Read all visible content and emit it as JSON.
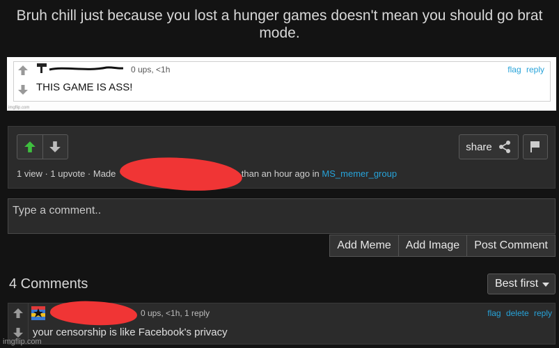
{
  "post": {
    "title": "Bruh chill just because you lost a hunger games doesn't mean you should go brat mode."
  },
  "meme_image": {
    "meta": "0 ups, <1h",
    "flag_label": "flag",
    "reply_label": "reply",
    "comment_text": "THIS GAME IS ASS!",
    "watermark": "imgflip.com"
  },
  "stats": {
    "views": "1 view",
    "upvotes": "1 upvote",
    "made_by_prefix": "Made",
    "made_suffix": "less than an hour ago in",
    "stream": "MS_memer_group"
  },
  "share": {
    "label": "share"
  },
  "comment_box": {
    "placeholder": "Type a comment..",
    "add_meme": "Add Meme",
    "add_image": "Add Image",
    "post_comment": "Post Comment"
  },
  "comments": {
    "count_label": "4 Comments",
    "sort_selected": "Best first",
    "items": [
      {
        "meta": "0 ups, <1h, 1 reply",
        "flag_label": "flag",
        "delete_label": "delete",
        "reply_label": "reply",
        "text": "your censorship is like Facebook's privacy"
      }
    ]
  },
  "watermark": "imgflip.com",
  "colors": {
    "background": "#131313",
    "panel": "#2b2b2b",
    "link": "#27a3d9",
    "upvote_active": "#3fbf3f",
    "redaction": "#f03535"
  },
  "icons": [
    "up-arrow-icon",
    "down-arrow-icon",
    "share-icon",
    "flag-icon",
    "caret-down-icon"
  ]
}
